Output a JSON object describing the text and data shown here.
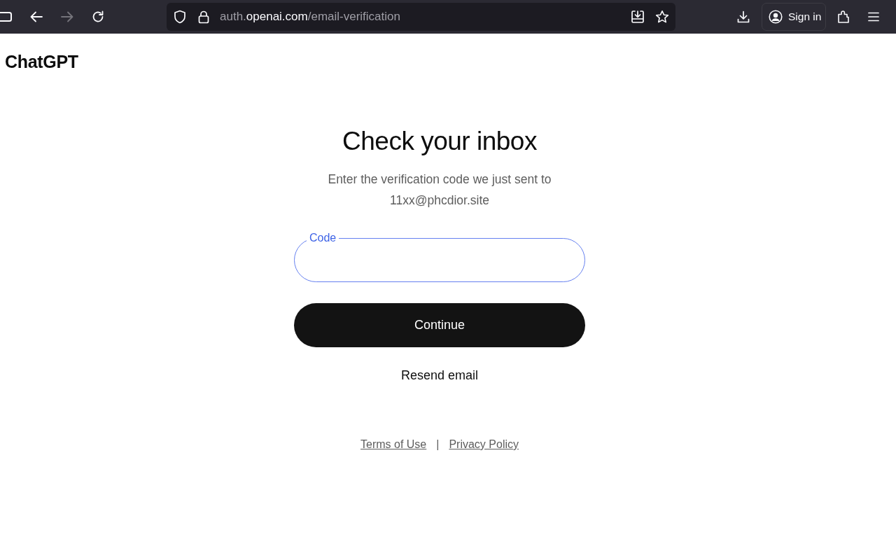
{
  "browser": {
    "nav_buttons": [
      {
        "kind": "sidebar",
        "disabled": false
      },
      {
        "kind": "back",
        "disabled": false
      },
      {
        "kind": "forward",
        "disabled": true
      },
      {
        "kind": "reload",
        "disabled": false
      }
    ],
    "address_bar": {
      "url_parts": [
        {
          "text": "auth.",
          "emphasis": false
        },
        {
          "text": "openai.com",
          "emphasis": true
        },
        {
          "text": "/email-verification",
          "emphasis": false
        }
      ]
    },
    "toolbar_buttons": [
      {
        "kind": "downloads"
      },
      {
        "kind": "account",
        "label": "Sign in"
      },
      {
        "kind": "extensions"
      },
      {
        "kind": "menu"
      }
    ]
  },
  "page": {
    "logo": "ChatGPT",
    "title": "Check your inbox",
    "message": "Enter the verification code we just sent to 11xx@phcdior.site",
    "code_field": {
      "label": "Code",
      "focused": true
    },
    "primary_button": "Continue",
    "secondary_button": "Resend email",
    "footer": {
      "links": [
        "Terms of Use",
        "Privacy Policy"
      ],
      "separator": "|"
    }
  }
}
